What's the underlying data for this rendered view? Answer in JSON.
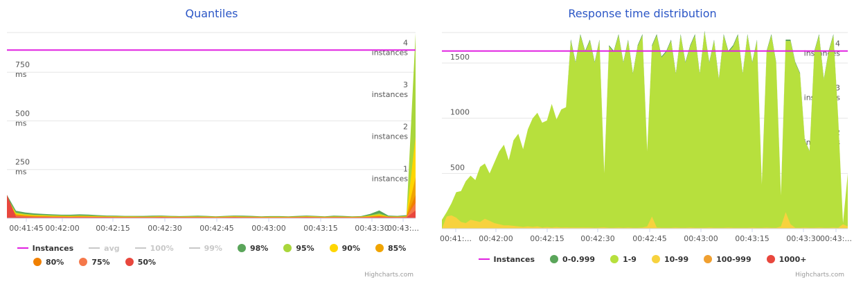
{
  "chart_data": [
    {
      "type": "area",
      "title": "Quantiles",
      "x_tick_labels": [
        "00:41:45",
        "00:42:00",
        "00:42:15",
        "00:42:30",
        "00:42:45",
        "00:43:00",
        "00:43:15",
        "00:43:30",
        "00:43:..."
      ],
      "y_tick_labels": [
        {
          "value": "250",
          "unit": "ms",
          "v": 250
        },
        {
          "value": "500",
          "unit": "ms",
          "v": 500
        },
        {
          "value": "750",
          "unit": "ms",
          "v": 750
        }
      ],
      "y2_tick_labels": [
        {
          "value": "1",
          "unit": "instances",
          "v": 1
        },
        {
          "value": "2",
          "unit": "instances",
          "v": 2
        },
        {
          "value": "3",
          "unit": "instances",
          "v": 3
        },
        {
          "value": "4",
          "unit": "instances",
          "v": 4
        }
      ],
      "ylim": [
        0,
        950
      ],
      "y2lim": [
        0,
        4.4
      ],
      "instances_level": 4,
      "series": [
        {
          "name": "98%",
          "color": "#5aa55a",
          "values": [
            120,
            38,
            30,
            25,
            22,
            20,
            18,
            18,
            20,
            19,
            16,
            14,
            13,
            12,
            12,
            12,
            13,
            14,
            12,
            11,
            12,
            13,
            12,
            10,
            12,
            14,
            13,
            12,
            10,
            11,
            11,
            10,
            12,
            14,
            12,
            10,
            13,
            12,
            10,
            11,
            22,
            40,
            14,
            12,
            16,
            120
          ]
        },
        {
          "name": "95%",
          "color": "#a9d63b",
          "values": [
            110,
            30,
            22,
            18,
            17,
            15,
            14,
            13,
            14,
            13,
            12,
            11,
            10,
            10,
            10,
            9,
            10,
            11,
            10,
            9,
            10,
            10,
            10,
            8,
            10,
            11,
            10,
            9,
            8,
            9,
            9,
            8,
            9,
            11,
            10,
            8,
            10,
            9,
            8,
            9,
            15,
            25,
            10,
            9,
            12,
            950
          ]
        },
        {
          "name": "90%",
          "color": "#ffd600",
          "values": [
            100,
            24,
            18,
            15,
            14,
            12,
            12,
            11,
            12,
            11,
            10,
            9,
            9,
            8,
            8,
            8,
            8,
            9,
            8,
            8,
            8,
            8,
            8,
            7,
            8,
            9,
            8,
            8,
            7,
            7,
            7,
            7,
            8,
            9,
            8,
            7,
            8,
            8,
            7,
            8,
            12,
            18,
            9,
            8,
            10,
            420
          ]
        },
        {
          "name": "85%",
          "color": "#f0a400",
          "values": [
            90,
            20,
            15,
            12,
            11,
            10,
            10,
            9,
            10,
            9,
            8,
            8,
            7,
            7,
            7,
            7,
            7,
            8,
            7,
            7,
            7,
            7,
            7,
            6,
            7,
            8,
            7,
            7,
            6,
            6,
            6,
            6,
            7,
            8,
            7,
            6,
            7,
            7,
            6,
            7,
            10,
            14,
            8,
            7,
            9,
            210
          ]
        },
        {
          "name": "80%",
          "color": "#f08000",
          "values": [
            80,
            16,
            12,
            10,
            9,
            8,
            8,
            7,
            8,
            8,
            7,
            7,
            6,
            6,
            6,
            6,
            6,
            7,
            6,
            6,
            6,
            6,
            6,
            5,
            6,
            7,
            6,
            6,
            5,
            5,
            5,
            5,
            6,
            7,
            6,
            5,
            6,
            6,
            5,
            6,
            8,
            11,
            7,
            6,
            8,
            120
          ]
        },
        {
          "name": "75%",
          "color": "#f5784a",
          "values": [
            70,
            13,
            10,
            8,
            8,
            7,
            7,
            6,
            7,
            7,
            6,
            6,
            5,
            5,
            5,
            5,
            5,
            6,
            5,
            5,
            5,
            5,
            5,
            4,
            5,
            6,
            5,
            5,
            4,
            4,
            4,
            4,
            5,
            6,
            5,
            4,
            5,
            5,
            4,
            5,
            7,
            9,
            6,
            5,
            7,
            80
          ]
        },
        {
          "name": "50%",
          "color": "#e8473d",
          "values": [
            120,
            8,
            6,
            5,
            5,
            4,
            4,
            4,
            4,
            4,
            4,
            4,
            3,
            3,
            3,
            3,
            3,
            4,
            3,
            3,
            3,
            3,
            3,
            3,
            3,
            4,
            3,
            3,
            3,
            3,
            3,
            3,
            3,
            4,
            3,
            3,
            3,
            3,
            3,
            3,
            4,
            5,
            4,
            3,
            4,
            40
          ]
        }
      ],
      "legend": {
        "row1": [
          {
            "label": "Instances",
            "color": "#e020e0",
            "symbol": "line",
            "enabled": true
          },
          {
            "label": "avg",
            "color": "#c8c8c8",
            "symbol": "line",
            "enabled": false
          },
          {
            "label": "100%",
            "color": "#c8c8c8",
            "symbol": "line",
            "enabled": false
          },
          {
            "label": "99%",
            "color": "#c8c8c8",
            "symbol": "line",
            "enabled": false
          },
          {
            "label": "98%",
            "color": "#5aa55a",
            "symbol": "dot",
            "enabled": true
          },
          {
            "label": "95%",
            "color": "#a9d63b",
            "symbol": "dot",
            "enabled": true
          },
          {
            "label": "90%",
            "color": "#ffd600",
            "symbol": "dot",
            "enabled": true
          },
          {
            "label": "85%",
            "color": "#f0a400",
            "symbol": "dot",
            "enabled": true
          }
        ],
        "row2": [
          {
            "label": "80%",
            "color": "#f08000",
            "symbol": "dot",
            "enabled": true
          },
          {
            "label": "75%",
            "color": "#f5784a",
            "symbol": "dot",
            "enabled": true
          },
          {
            "label": "50%",
            "color": "#e8473d",
            "symbol": "dot",
            "enabled": true
          }
        ]
      },
      "credits": "Highcharts.com"
    },
    {
      "type": "area",
      "title": "Response time distribution",
      "x_tick_labels": [
        "00:41:...",
        "00:42:00",
        "00:42:15",
        "00:42:30",
        "00:42:45",
        "00:43:00",
        "00:43:15",
        "00:43:30",
        "00:43:..."
      ],
      "y_tick_labels": [
        {
          "value": "500",
          "unit": "",
          "v": 500
        },
        {
          "value": "1000",
          "unit": "",
          "v": 1000
        },
        {
          "value": "1500",
          "unit": "",
          "v": 1500
        }
      ],
      "y2_tick_labels": [
        {
          "value": "1",
          "unit": "instances",
          "v": 1
        },
        {
          "value": "2",
          "unit": "instances",
          "v": 2
        },
        {
          "value": "3",
          "unit": "instances",
          "v": 3
        },
        {
          "value": "4",
          "unit": "instances",
          "v": 4
        }
      ],
      "ylim": [
        0,
        1770
      ],
      "y2lim": [
        0,
        4.4
      ],
      "instances_level": 4,
      "series_1_9": [
        80,
        150,
        230,
        330,
        340,
        430,
        480,
        440,
        560,
        590,
        500,
        600,
        700,
        760,
        620,
        800,
        860,
        720,
        900,
        1000,
        1050,
        960,
        980,
        1130,
        990,
        1080,
        1100,
        1700,
        1500,
        1750,
        1600,
        1700,
        1500,
        1700,
        500,
        1650,
        1600,
        1750,
        1500,
        1700,
        1400,
        1650,
        1750,
        700,
        1650,
        1750,
        1550,
        1600,
        1700,
        1400,
        1750,
        1500,
        1650,
        1750,
        1400,
        1780,
        1500,
        1700,
        1350,
        1750,
        1600,
        1650,
        1750,
        1400,
        1750,
        1500,
        1700,
        400,
        1600,
        1750,
        1500,
        300,
        1700,
        1700,
        1500,
        1400,
        800,
        700,
        1600,
        1750,
        1350,
        1600,
        1750,
        1000,
        50,
        500
      ],
      "series_0_0999": [
        0,
        0,
        0,
        0,
        0,
        0,
        0,
        0,
        0,
        0,
        0,
        0,
        0,
        0,
        0,
        0,
        0,
        0,
        0,
        0,
        0,
        0,
        0,
        0,
        0,
        0,
        0,
        15,
        10,
        12,
        10,
        12,
        10,
        12,
        5,
        12,
        10,
        12,
        10,
        12,
        10,
        12,
        12,
        5,
        12,
        12,
        10,
        10,
        12,
        10,
        12,
        10,
        12,
        12,
        10,
        12,
        10,
        12,
        10,
        12,
        10,
        12,
        12,
        10,
        12,
        10,
        12,
        5,
        10,
        12,
        10,
        5,
        12,
        12,
        10,
        10,
        5,
        5,
        10,
        12,
        10,
        10,
        12,
        5,
        0,
        0
      ],
      "series_10_99": [
        0,
        110,
        120,
        100,
        60,
        50,
        80,
        70,
        60,
        90,
        70,
        50,
        40,
        30,
        30,
        25,
        20,
        15,
        20,
        15,
        20,
        10,
        15,
        10,
        15,
        10,
        12,
        10,
        10,
        10,
        10,
        10,
        8,
        10,
        12,
        8,
        8,
        10,
        8,
        10,
        8,
        8,
        10,
        20,
        110,
        10,
        8,
        8,
        8,
        10,
        8,
        8,
        10,
        8,
        8,
        8,
        10,
        8,
        8,
        8,
        10,
        8,
        8,
        8,
        8,
        10,
        8,
        8,
        10,
        8,
        8,
        20,
        150,
        40,
        8,
        8,
        10,
        8,
        8,
        10,
        8,
        8,
        10,
        8,
        40,
        20
      ],
      "legend": [
        {
          "label": "Instances",
          "color": "#e020e0",
          "symbol": "line"
        },
        {
          "label": "0-0.999",
          "color": "#5aa55a",
          "symbol": "dot"
        },
        {
          "label": "1-9",
          "color": "#b7e03d",
          "symbol": "dot"
        },
        {
          "label": "10-99",
          "color": "#f7d23e",
          "symbol": "dot"
        },
        {
          "label": "100-999",
          "color": "#f0a030",
          "symbol": "dot"
        },
        {
          "label": "1000+",
          "color": "#e8473d",
          "symbol": "dot"
        }
      ],
      "credits": "Highcharts.com"
    }
  ]
}
